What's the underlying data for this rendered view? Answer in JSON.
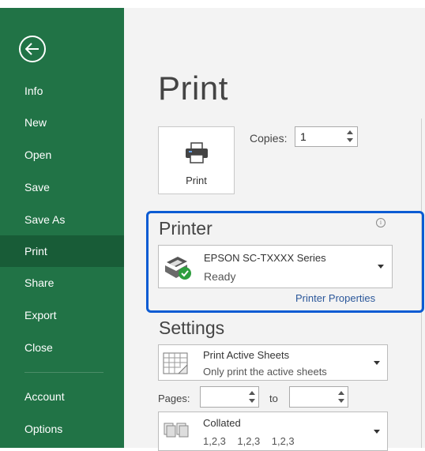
{
  "sidebar": {
    "items": [
      {
        "label": "Info"
      },
      {
        "label": "New"
      },
      {
        "label": "Open"
      },
      {
        "label": "Save"
      },
      {
        "label": "Save As"
      },
      {
        "label": "Print",
        "active": true
      },
      {
        "label": "Share"
      },
      {
        "label": "Export"
      },
      {
        "label": "Close"
      },
      {
        "label": "Account"
      },
      {
        "label": "Options"
      }
    ]
  },
  "main": {
    "title": "Print",
    "print_button_label": "Print",
    "copies": {
      "label": "Copies:",
      "value": "1"
    }
  },
  "printer": {
    "heading": "Printer",
    "name": "EPSON SC-TXXXX Series",
    "status": "Ready",
    "properties_link": "Printer Properties",
    "info_glyph": "i"
  },
  "settings": {
    "heading": "Settings",
    "scope": {
      "title": "Print Active Sheets",
      "subtitle": "Only print the active sheets"
    },
    "pages": {
      "label": "Pages:",
      "to_label": "to",
      "from_value": "",
      "to_value": ""
    },
    "collation": {
      "title": "Collated",
      "subtitle": "1,2,3    1,2,3    1,2,3"
    }
  },
  "colors": {
    "sidebar_bg": "#217346",
    "sidebar_active": "#185c37",
    "link": "#2b579a",
    "highlight_frame": "#0b5bd3",
    "status_ok": "#2e9e3e"
  }
}
